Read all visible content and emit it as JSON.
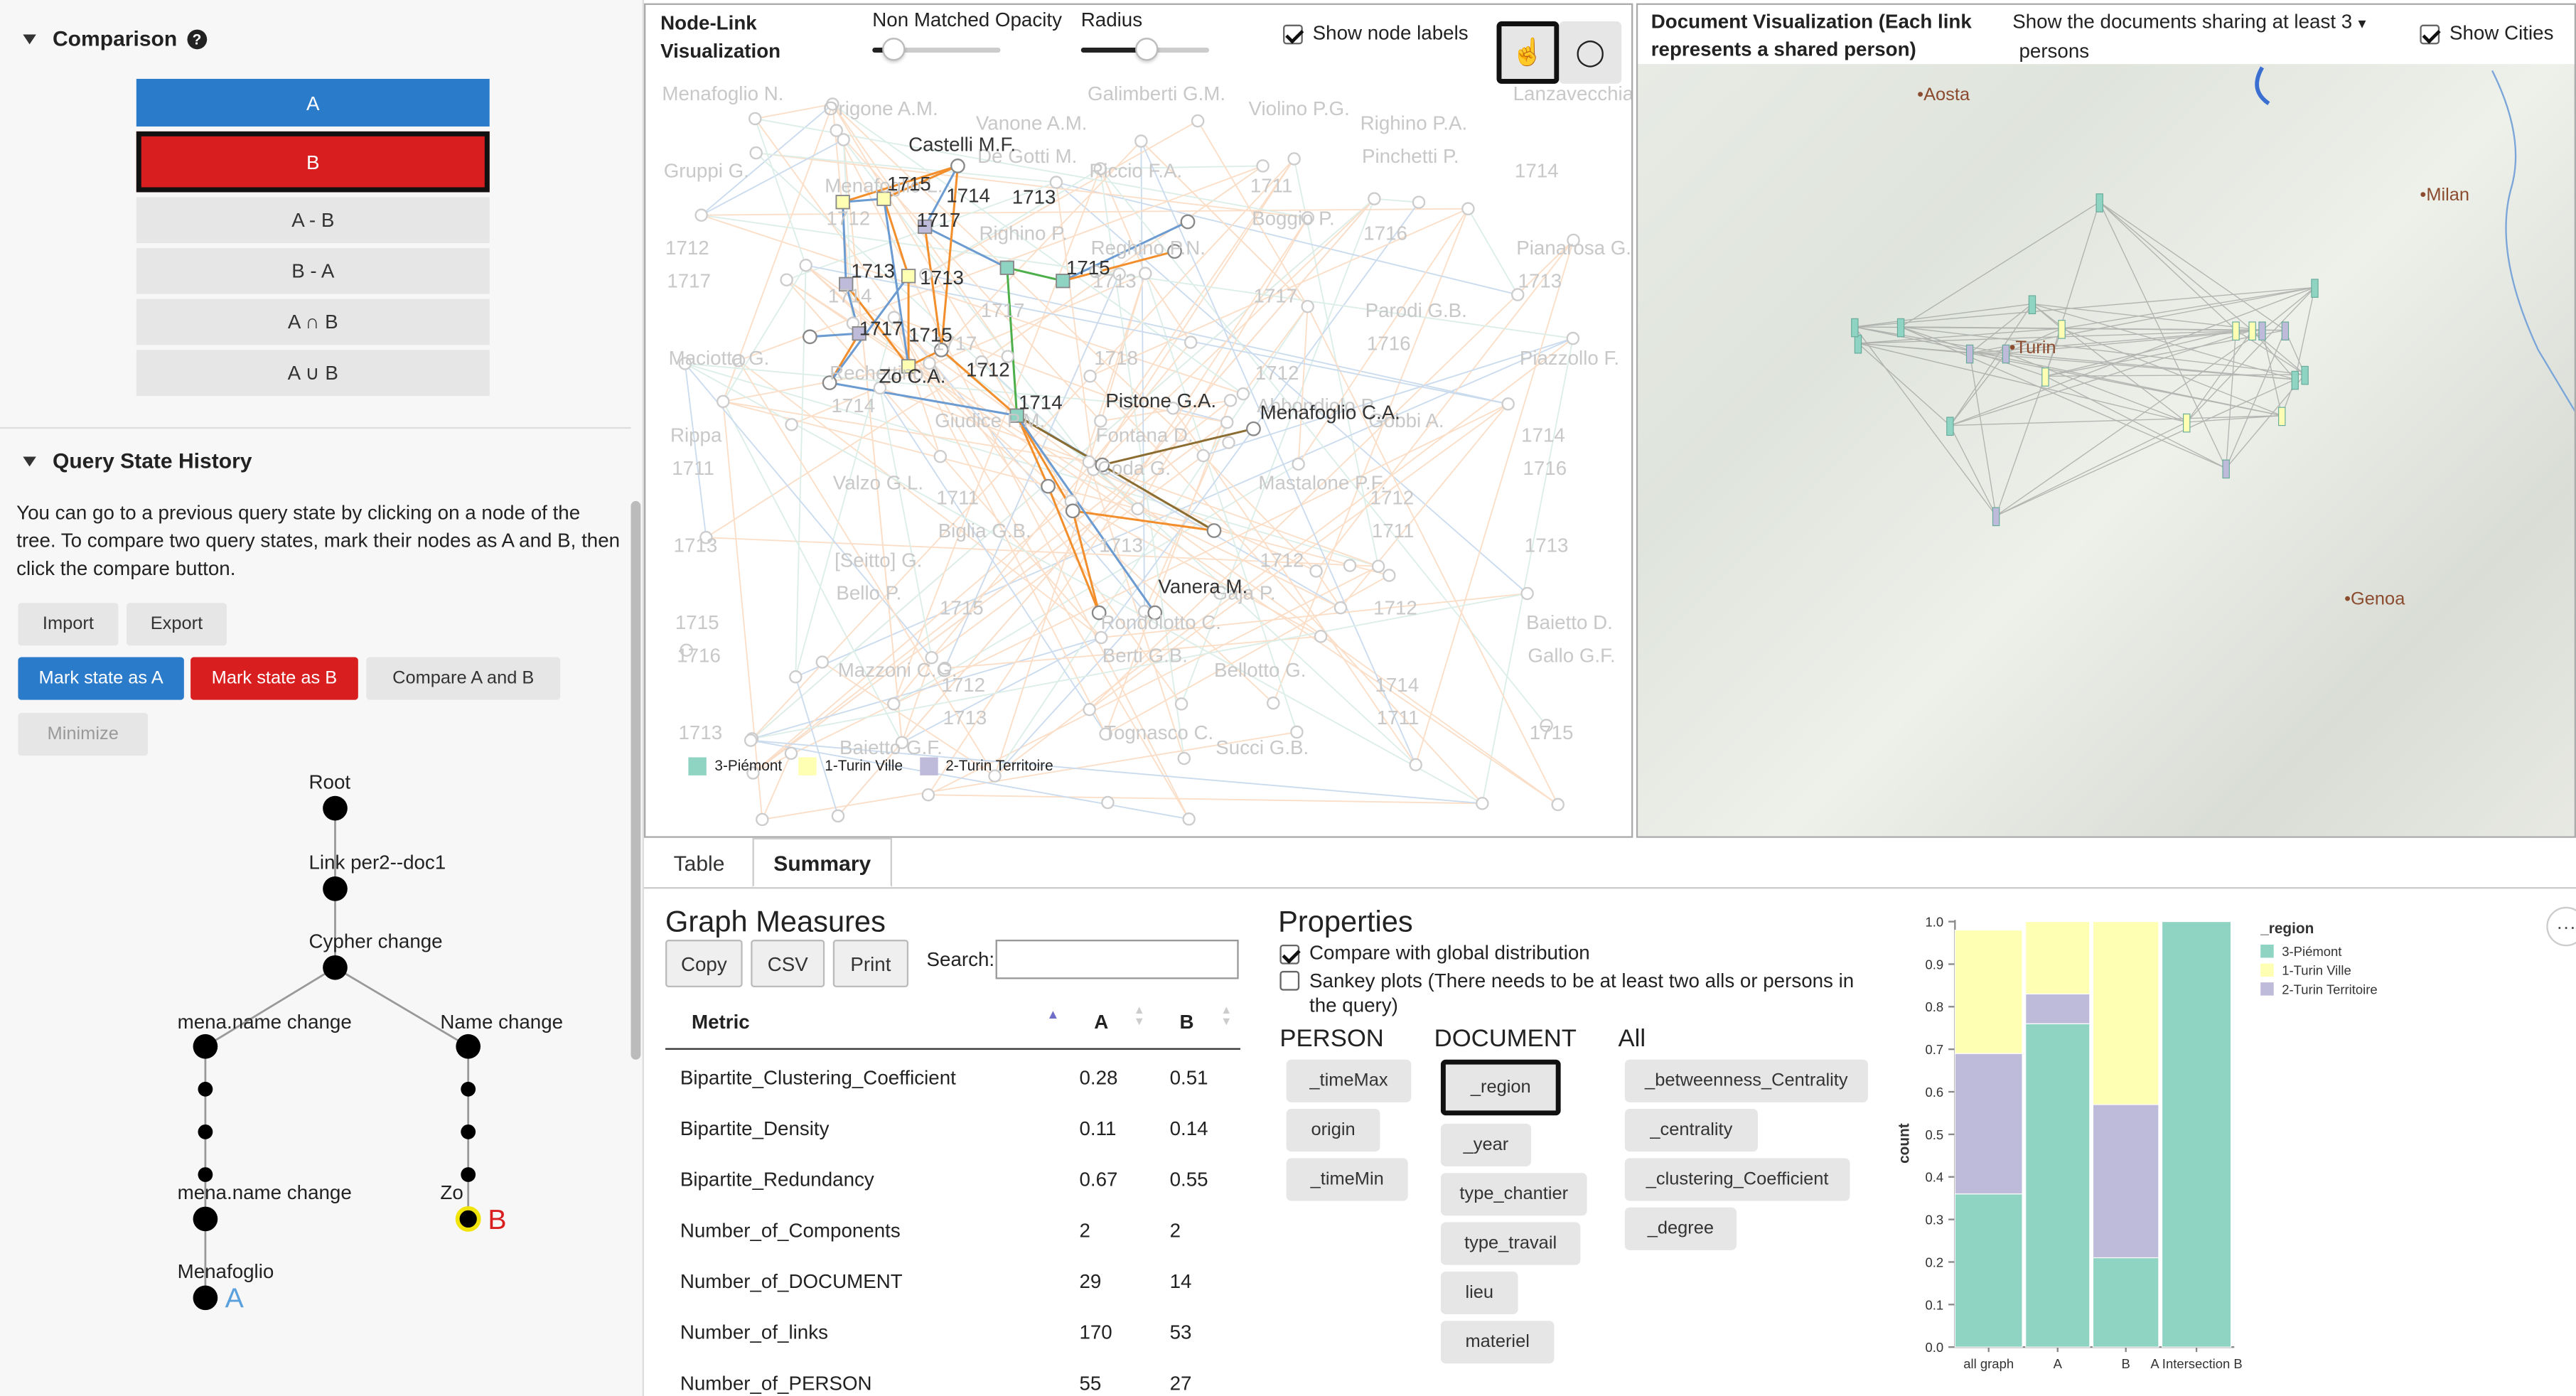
{
  "comparison": {
    "title": "Comparison",
    "help_icon": "question-circle-icon",
    "buttons": [
      "A",
      "B",
      "A - B",
      "B - A",
      "A ∩ B",
      "A ∪ B"
    ],
    "colors": {
      "a": "#2b7bcb",
      "b": "#d81e1e"
    }
  },
  "history": {
    "title": "Query State History",
    "description": "You can go to a previous query state by clicking on a node of the tree. To compare two query states, mark their nodes as A and B, then click the compare button.",
    "import_label": "Import",
    "export_label": "Export",
    "mark_a_label": "Mark state as A",
    "mark_b_label": "Mark state as B",
    "compare_label": "Compare A and B",
    "minimize_label": "Minimize",
    "tree": {
      "root": "Root",
      "n1": "Link per2--doc1",
      "n2": "Cypher change",
      "left1": "mena.name change",
      "right1": "Name change",
      "left2": "mena.name change",
      "left3": "Menafoglio",
      "right2": "Zo",
      "marker_a": "A",
      "marker_b": "B"
    }
  },
  "nodelink": {
    "title_line1": "Node-Link",
    "title_line2": "Visualization",
    "non_matched_label": "Non Matched Opacity",
    "radius_label": "Radius",
    "show_labels": "Show node labels",
    "pointer_icon": "hand-pointer-icon",
    "lasso_icon": "lasso-icon",
    "legend": [
      {
        "label": "3-Piémont",
        "color": "#8fd3c3"
      },
      {
        "label": "1-Turin Ville",
        "color": "#ffffb3"
      },
      {
        "label": "2-Turin Territoire",
        "color": "#bebada"
      }
    ],
    "bold_labels": [
      "Castelli M.F.",
      "1715",
      "1714",
      "1713",
      "1717",
      "1713",
      "1713",
      "1715",
      "1717",
      "1715",
      "Zo C.A.",
      "1712",
      "1714",
      "Pistone G.A.",
      "Menafoglio C.A.",
      "Vanera M."
    ],
    "faded_labels": [
      "Menafoglio N.",
      "Origone A.M.",
      "Vanone A.M.",
      "Galimberti G.M.",
      "Violino P.G.",
      "Righino P.A.",
      "Lanzavecchia G.",
      "Gruppi G.",
      "Menafoglio L.",
      "De Gotti M.",
      "Riccio F.A.",
      "1711",
      "Pinchetti P.",
      "1714",
      "1712",
      "1712",
      "Righino P.",
      "Reghino P.N.",
      "Boggio P.",
      "1716",
      "Pianarosa G.",
      "1717",
      "1714",
      "1717",
      "1713",
      "1717",
      "Parodi G.B.",
      "1713",
      "Maciotta G.",
      "Rechettino A.",
      "1717",
      "1718",
      "1712",
      "1716",
      "Piazzollo F.",
      "Rippa",
      "1714",
      "Giudice P.M.",
      "Fontana D.",
      "Abbondiolo P.",
      "Gobbi A.",
      "1714",
      "1711",
      "Valzo G.L.",
      "1711",
      "Coda G.",
      "Mastalone P.F.",
      "1712",
      "1716",
      "1713",
      "[Seitto] G.",
      "Biglia G.B.",
      "1713",
      "1712",
      "1711",
      "1713",
      "1715",
      "Bello P.",
      "1715",
      "Rondolotto C.",
      "Gaja P.",
      "1712",
      "Baietto D.",
      "1716",
      "Mazzoni C.G.",
      "1712",
      "Berti G.B.",
      "Bellotto G.",
      "1714",
      "Gallo G.F.",
      "1713",
      "Baietto G.F.",
      "1713",
      "Tognasco C.",
      "Succi G.B.",
      "1711",
      "1715"
    ]
  },
  "docviz": {
    "title_line1": "Document Visualization (Each link",
    "title_line2": "represents a shared person)",
    "sharing_line1": "Show the documents sharing at least",
    "sharing_line2": "persons",
    "sharing_value": "3",
    "show_cities": "Show Cities",
    "cities": [
      "Aosta",
      "Milan",
      "Turin",
      "Genoa"
    ]
  },
  "tabs": {
    "table": "Table",
    "summary": "Summary"
  },
  "measures": {
    "title": "Graph Measures",
    "copy": "Copy",
    "csv": "CSV",
    "print": "Print",
    "search_label": "Search:",
    "col_metric": "Metric",
    "col_a": "A",
    "col_b": "B",
    "rows": [
      {
        "metric": "Bipartite_Clustering_Coefficient",
        "a": "0.28",
        "b": "0.51"
      },
      {
        "metric": "Bipartite_Density",
        "a": "0.11",
        "b": "0.14"
      },
      {
        "metric": "Bipartite_Redundancy",
        "a": "0.67",
        "b": "0.55"
      },
      {
        "metric": "Number_of_Components",
        "a": "2",
        "b": "2"
      },
      {
        "metric": "Number_of_DOCUMENT",
        "a": "29",
        "b": "14"
      },
      {
        "metric": "Number_of_links",
        "a": "170",
        "b": "53"
      },
      {
        "metric": "Number_of_PERSON",
        "a": "55",
        "b": "27"
      }
    ]
  },
  "properties": {
    "title": "Properties",
    "compare_global": "Compare with global distribution",
    "sankey_line1": "Sankey plots (There needs to be at least two alls or persons in",
    "sankey_line2": "the query)",
    "person_title": "PERSON",
    "document_title": "DOCUMENT",
    "all_title": "All",
    "person": [
      "_timeMax",
      "origin",
      "_timeMin"
    ],
    "document": [
      "_region",
      "_year",
      "type_chantier",
      "type_travail",
      "lieu",
      "materiel"
    ],
    "all": [
      "_betweenness_Centrality",
      "_centrality",
      "_clustering_Coefficient",
      "_degree"
    ]
  },
  "chart_data": {
    "type": "bar",
    "stacked": true,
    "categories": [
      "all graph",
      "A",
      "B",
      "A Intersection B"
    ],
    "series": [
      {
        "name": "3-Piémont",
        "color": "#8fd3c3",
        "values": [
          0.36,
          0.76,
          0.21,
          1.0
        ]
      },
      {
        "name": "2-Turin Territoire",
        "color": "#bebada",
        "values": [
          0.33,
          0.07,
          0.36,
          0.0
        ]
      },
      {
        "name": "1-Turin Ville",
        "color": "#ffffb3",
        "values": [
          0.29,
          0.17,
          0.43,
          0.0
        ]
      }
    ],
    "legend_title": "_region",
    "legend": [
      {
        "name": "3-Piémont",
        "color": "#8fd3c3"
      },
      {
        "name": "1-Turin Ville",
        "color": "#ffffb3"
      },
      {
        "name": "2-Turin Territoire",
        "color": "#bebada"
      }
    ],
    "ylabel": "count",
    "ylim": [
      0,
      1.0
    ],
    "yticks": [
      "0.0",
      "0.1",
      "0.2",
      "0.3",
      "0.4",
      "0.5",
      "0.6",
      "0.7",
      "0.8",
      "0.9",
      "1.0"
    ],
    "more_icon": "ellipsis-icon"
  }
}
